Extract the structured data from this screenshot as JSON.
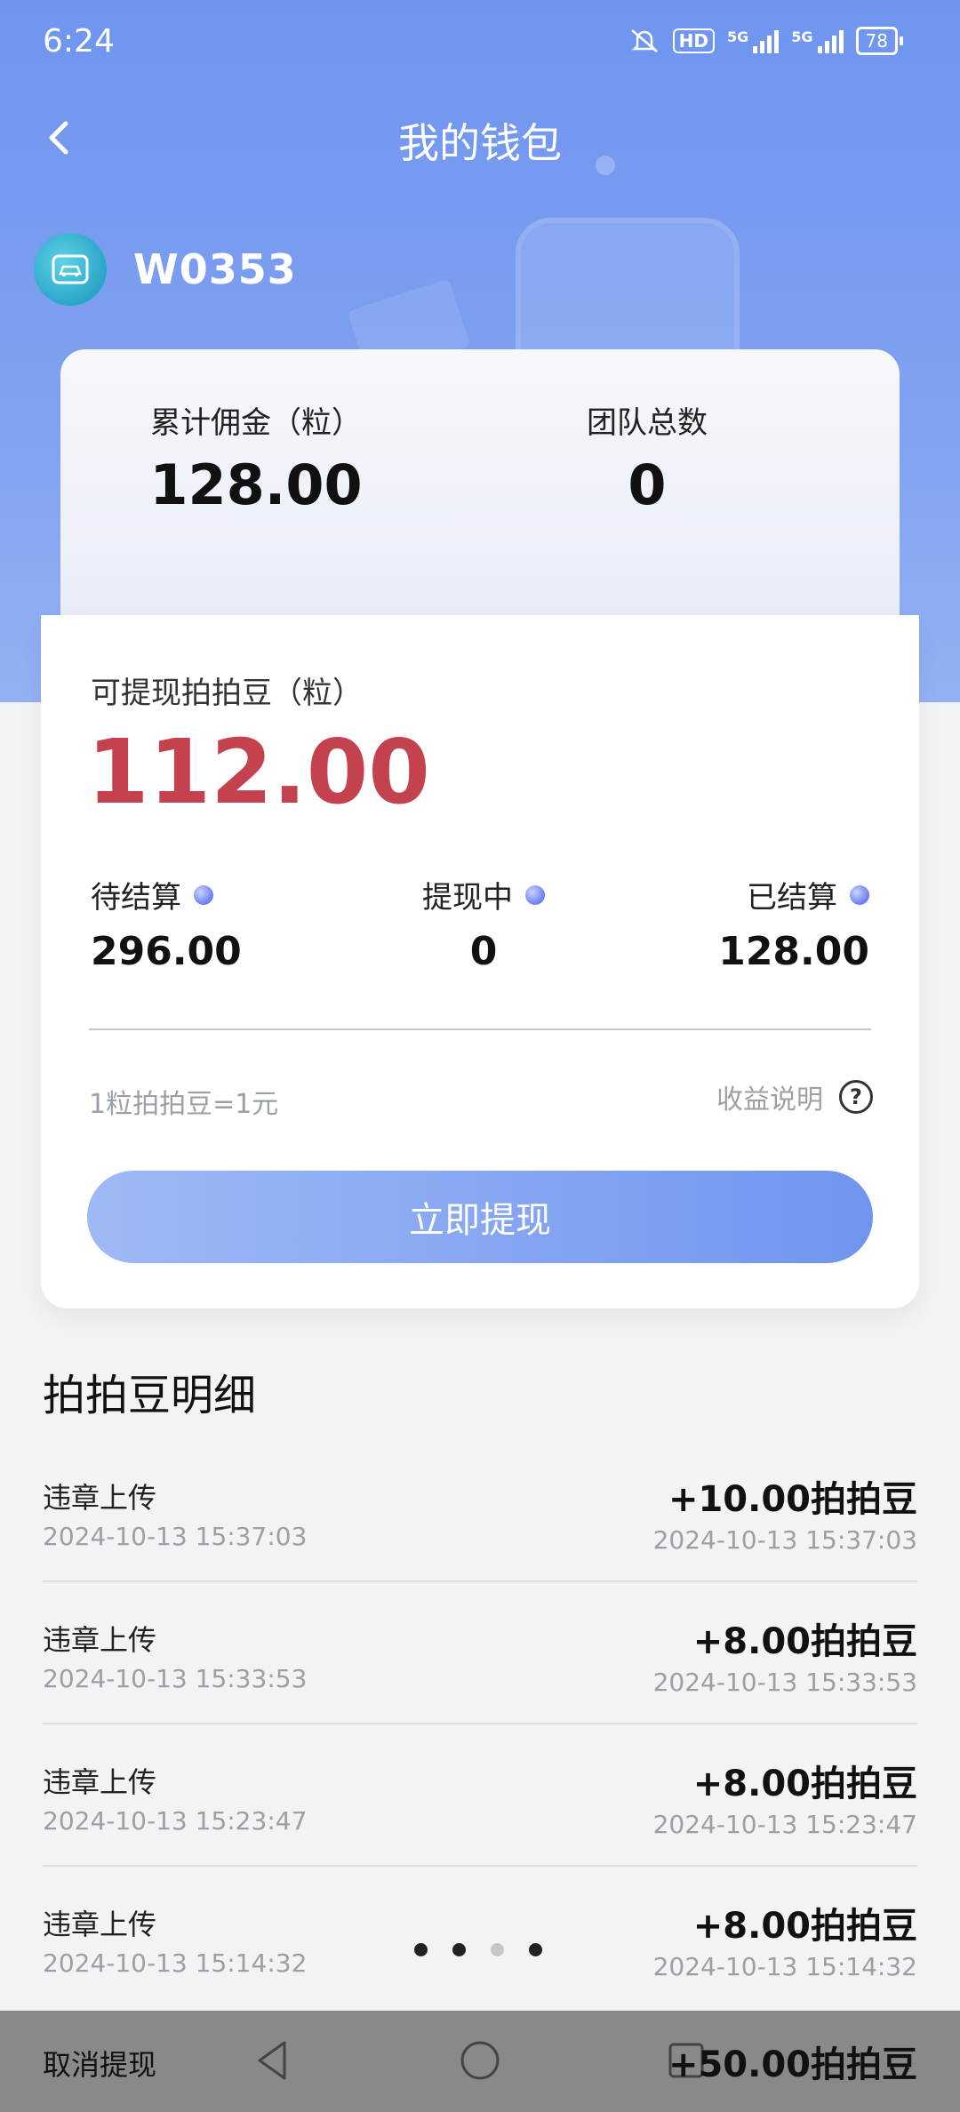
{
  "status_bar": {
    "time": "6:24",
    "hd_label": "HD",
    "net1": "5G",
    "net2": "5G",
    "battery": "78"
  },
  "header": {
    "back_icon": "chevron-left-icon",
    "title": "我的钱包"
  },
  "user": {
    "avatar_icon": "car-icon",
    "name": "W0353"
  },
  "summary": {
    "commission_label": "累计佣金（粒）",
    "commission_value": "128.00",
    "team_label": "团队总数",
    "team_value": "0"
  },
  "wallet": {
    "available_label": "可提现拍拍豆（粒）",
    "available_value": "112.00",
    "pending_label": "待结算",
    "pending_value": "296.00",
    "withdrawing_label": "提现中",
    "withdrawing_value": "0",
    "settled_label": "已结算",
    "settled_value": "128.00",
    "rate_text": "1粒拍拍豆=1元",
    "explain_label": "收益说明",
    "help_icon_glyph": "?",
    "withdraw_button": "立即提现"
  },
  "details": {
    "title": "拍拍豆明细",
    "rows": [
      {
        "type": "违章上传",
        "time_left": "2024-10-13 15:37:03",
        "amount": "+10.00拍拍豆",
        "time_right": "2024-10-13 15:37:03"
      },
      {
        "type": "违章上传",
        "time_left": "2024-10-13 15:33:53",
        "amount": "+8.00拍拍豆",
        "time_right": "2024-10-13 15:33:53"
      },
      {
        "type": "违章上传",
        "time_left": "2024-10-13 15:23:47",
        "amount": "+8.00拍拍豆",
        "time_right": "2024-10-13 15:23:47"
      },
      {
        "type": "违章上传",
        "time_left": "2024-10-13 15:14:32",
        "amount": "+8.00拍拍豆",
        "time_right": "2024-10-13 15:14:32"
      }
    ]
  },
  "bottom": {
    "cancel_label": "取消提现",
    "amount": "+50.00拍拍豆"
  },
  "colors": {
    "accent_blue": "#6f95ef",
    "amount_red": "#c4414e"
  }
}
